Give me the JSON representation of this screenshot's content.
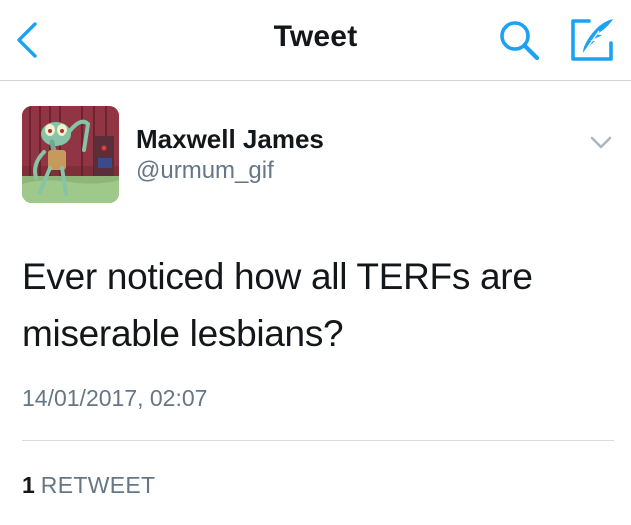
{
  "header": {
    "title": "Tweet",
    "back_icon": "chevron-left-icon",
    "search_icon": "search-icon",
    "compose_icon": "compose-quill-icon",
    "accent_color": "#1da1f2"
  },
  "author": {
    "name": "Maxwell James",
    "handle": "@urmum_gif",
    "avatar_icon": "cartoon-avatar-image",
    "menu_icon": "chevron-down-icon"
  },
  "tweet": {
    "text": "Ever noticed how all TERFs are miserable lesbians?",
    "timestamp": "14/01/2017, 02:07"
  },
  "stats": {
    "retweet_count": "1",
    "retweet_label": "RETWEET"
  }
}
